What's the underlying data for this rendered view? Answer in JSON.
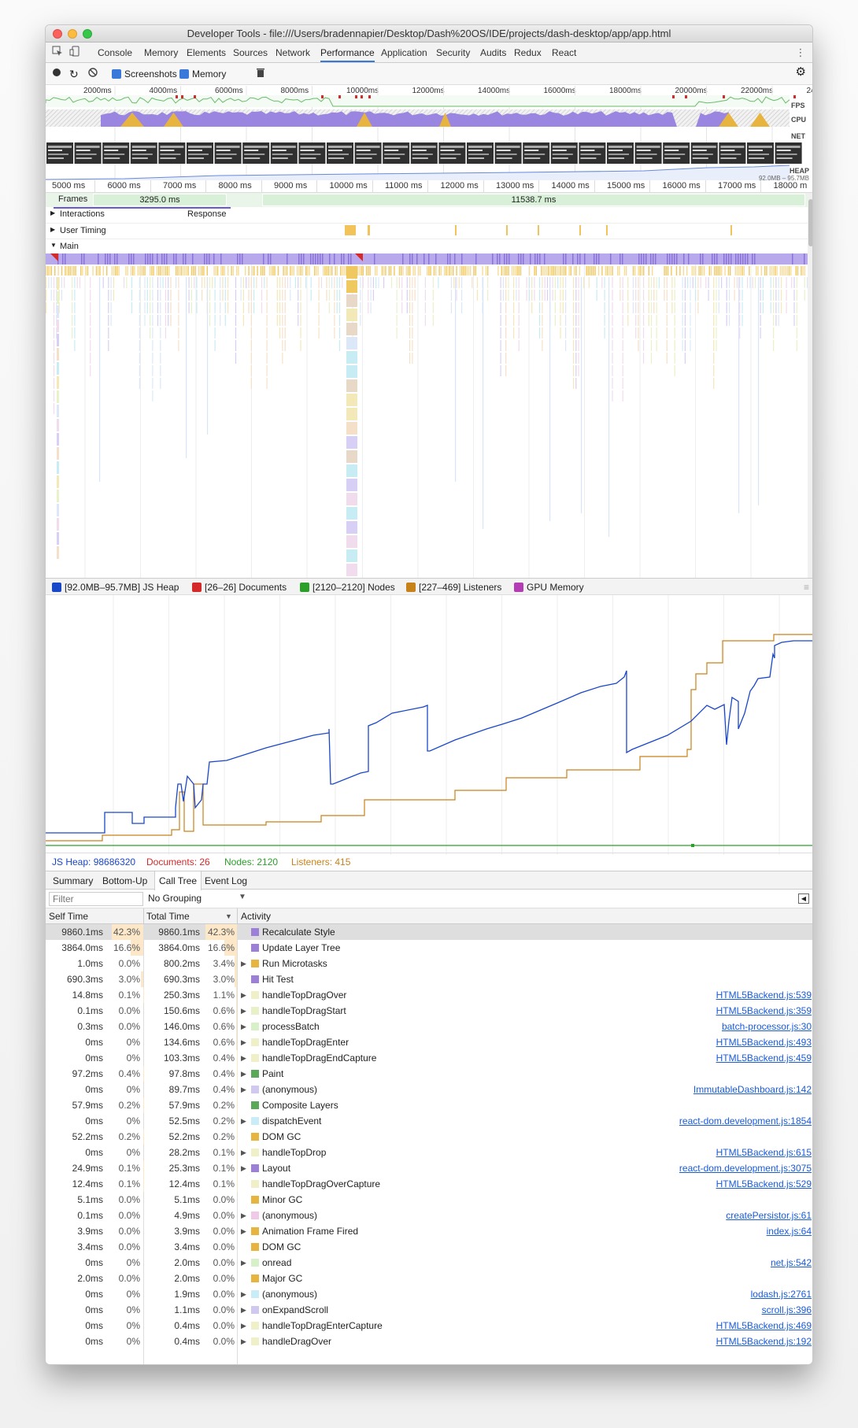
{
  "window": {
    "title": "Developer Tools - file:///Users/bradennapier/Desktop/Dash%20OS/IDE/projects/dash-desktop/app/app.html"
  },
  "tabs": [
    "Console",
    "Memory",
    "Elements",
    "Sources",
    "Network",
    "Performance",
    "Application",
    "Security",
    "Audits",
    "Redux",
    "React"
  ],
  "active_tab": "Performance",
  "toolbar": {
    "screenshots_label": "Screenshots",
    "memory_label": "Memory"
  },
  "overview": {
    "ticks": [
      "2000ms",
      "4000ms",
      "6000ms",
      "8000ms",
      "10000ms",
      "12000ms",
      "14000ms",
      "16000ms",
      "18000ms",
      "20000ms",
      "22000ms",
      "24"
    ],
    "fps_label": "FPS",
    "cpu_label": "CPU",
    "net_label": "NET",
    "heap_label": "HEAP",
    "heap_range": "92.0MB – 95.7MB"
  },
  "timeline": {
    "ticks": [
      "5000 ms",
      "6000 ms",
      "7000 ms",
      "8000 ms",
      "9000 ms",
      "10000 ms",
      "11000 ms",
      "12000 ms",
      "13000 ms",
      "14000 ms",
      "15000 ms",
      "16000 ms",
      "17000 ms",
      "18000 m"
    ],
    "frames_label": "Frames",
    "frame1": "3295.0 ms",
    "frame2": "11538.7 ms",
    "interactions_label": "Interactions",
    "response_label": "Response",
    "user_timing_label": "User Timing",
    "main_label": "Main"
  },
  "counters": {
    "heap": "[92.0MB–95.7MB]",
    "heap_label": "JS Heap",
    "documents": "[26–26]",
    "documents_label": "Documents",
    "nodes": "[2120–2120]",
    "nodes_label": "Nodes",
    "listeners": "[227–469]",
    "listeners_label": "Listeners",
    "gpu_label": "GPU Memory",
    "colors": {
      "heap": "#1a47c8",
      "documents": "#d42a2a",
      "nodes": "#2aa02a",
      "listeners": "#c8821a",
      "gpu": "#b43cb4"
    }
  },
  "readout": {
    "heap": "JS Heap: 98686320",
    "documents": "Documents: 26",
    "nodes": "Nodes: 2120",
    "listeners": "Listeners: 415"
  },
  "bottom_tabs": [
    "Summary",
    "Bottom-Up",
    "Call Tree",
    "Event Log"
  ],
  "active_bottom_tab": "Call Tree",
  "filter": {
    "placeholder": "Filter",
    "grouping": "No Grouping"
  },
  "table": {
    "headers": {
      "self": "Self Time",
      "total": "Total Time",
      "activity": "Activity"
    },
    "rows": [
      {
        "self": "9860.1ms",
        "self_pct": "42.3%",
        "total": "9860.1ms",
        "total_pct": "42.3%",
        "activity": "Recalculate Style",
        "color": "#9b7fd8",
        "expand": false,
        "link": "",
        "sp": 42.3,
        "tp": 42.3
      },
      {
        "self": "3864.0ms",
        "self_pct": "16.6%",
        "total": "3864.0ms",
        "total_pct": "16.6%",
        "activity": "Update Layer Tree",
        "color": "#9b7fd8",
        "expand": false,
        "link": "",
        "sp": 16.6,
        "tp": 16.6
      },
      {
        "self": "1.0ms",
        "self_pct": "0.0%",
        "total": "800.2ms",
        "total_pct": "3.4%",
        "activity": "Run Microtasks",
        "color": "#e8b440",
        "expand": true,
        "link": "",
        "sp": 0,
        "tp": 3.4
      },
      {
        "self": "690.3ms",
        "self_pct": "3.0%",
        "total": "690.3ms",
        "total_pct": "3.0%",
        "activity": "Hit Test",
        "color": "#9b7fd8",
        "expand": false,
        "link": "",
        "sp": 3.0,
        "tp": 3.0
      },
      {
        "self": "14.8ms",
        "self_pct": "0.1%",
        "total": "250.3ms",
        "total_pct": "1.1%",
        "activity": "handleTopDragOver",
        "color": "#f0f0c8",
        "expand": true,
        "link": "HTML5Backend.js:539",
        "sp": 0.1,
        "tp": 1.1
      },
      {
        "self": "0.1ms",
        "self_pct": "0.0%",
        "total": "150.6ms",
        "total_pct": "0.6%",
        "activity": "handleTopDragStart",
        "color": "#e8f0c8",
        "expand": true,
        "link": "HTML5Backend.js:359",
        "sp": 0,
        "tp": 0.6
      },
      {
        "self": "0.3ms",
        "self_pct": "0.0%",
        "total": "146.0ms",
        "total_pct": "0.6%",
        "activity": "processBatch",
        "color": "#d8f0c8",
        "expand": true,
        "link": "batch-processor.js:30",
        "sp": 0,
        "tp": 0.6
      },
      {
        "self": "0ms",
        "self_pct": "0%",
        "total": "134.6ms",
        "total_pct": "0.6%",
        "activity": "handleTopDragEnter",
        "color": "#f0f0c8",
        "expand": true,
        "link": "HTML5Backend.js:493",
        "sp": 0,
        "tp": 0.6
      },
      {
        "self": "0ms",
        "self_pct": "0%",
        "total": "103.3ms",
        "total_pct": "0.4%",
        "activity": "handleTopDragEndCapture",
        "color": "#f0f0c8",
        "expand": true,
        "link": "HTML5Backend.js:459",
        "sp": 0,
        "tp": 0.4
      },
      {
        "self": "97.2ms",
        "self_pct": "0.4%",
        "total": "97.8ms",
        "total_pct": "0.4%",
        "activity": "Paint",
        "color": "#5aa85a",
        "expand": true,
        "link": "",
        "sp": 0.4,
        "tp": 0.4
      },
      {
        "self": "0ms",
        "self_pct": "0%",
        "total": "89.7ms",
        "total_pct": "0.4%",
        "activity": "(anonymous)",
        "color": "#d0c8f0",
        "expand": true,
        "link": "ImmutableDashboard.js:142",
        "sp": 0,
        "tp": 0.4
      },
      {
        "self": "57.9ms",
        "self_pct": "0.2%",
        "total": "57.9ms",
        "total_pct": "0.2%",
        "activity": "Composite Layers",
        "color": "#5aa85a",
        "expand": false,
        "link": "",
        "sp": 0.2,
        "tp": 0.2
      },
      {
        "self": "0ms",
        "self_pct": "0%",
        "total": "52.5ms",
        "total_pct": "0.2%",
        "activity": "dispatchEvent",
        "color": "#c8ecf8",
        "expand": true,
        "link": "react-dom.development.js:1854",
        "sp": 0,
        "tp": 0.2
      },
      {
        "self": "52.2ms",
        "self_pct": "0.2%",
        "total": "52.2ms",
        "total_pct": "0.2%",
        "activity": "DOM GC",
        "color": "#e8b440",
        "expand": false,
        "link": "",
        "sp": 0.2,
        "tp": 0.2
      },
      {
        "self": "0ms",
        "self_pct": "0%",
        "total": "28.2ms",
        "total_pct": "0.1%",
        "activity": "handleTopDrop",
        "color": "#f0f0c8",
        "expand": true,
        "link": "HTML5Backend.js:615",
        "sp": 0,
        "tp": 0.1
      },
      {
        "self": "24.9ms",
        "self_pct": "0.1%",
        "total": "25.3ms",
        "total_pct": "0.1%",
        "activity": "Layout",
        "color": "#9b7fd8",
        "expand": true,
        "link": "react-dom.development.js:3075",
        "sp": 0.1,
        "tp": 0.1
      },
      {
        "self": "12.4ms",
        "self_pct": "0.1%",
        "total": "12.4ms",
        "total_pct": "0.1%",
        "activity": "handleTopDragOverCapture",
        "color": "#f0f0c8",
        "expand": false,
        "link": "HTML5Backend.js:529",
        "sp": 0.1,
        "tp": 0.1
      },
      {
        "self": "5.1ms",
        "self_pct": "0.0%",
        "total": "5.1ms",
        "total_pct": "0.0%",
        "activity": "Minor GC",
        "color": "#e8b440",
        "expand": false,
        "link": "",
        "sp": 0,
        "tp": 0
      },
      {
        "self": "0.1ms",
        "self_pct": "0.0%",
        "total": "4.9ms",
        "total_pct": "0.0%",
        "activity": "(anonymous)",
        "color": "#f0c8e8",
        "expand": true,
        "link": "createPersistor.js:61",
        "sp": 0,
        "tp": 0
      },
      {
        "self": "3.9ms",
        "self_pct": "0.0%",
        "total": "3.9ms",
        "total_pct": "0.0%",
        "activity": "Animation Frame Fired",
        "color": "#e8b440",
        "expand": true,
        "link": "index.js:64",
        "sp": 0,
        "tp": 0
      },
      {
        "self": "3.4ms",
        "self_pct": "0.0%",
        "total": "3.4ms",
        "total_pct": "0.0%",
        "activity": "DOM GC",
        "color": "#e8b440",
        "expand": false,
        "link": "",
        "sp": 0,
        "tp": 0
      },
      {
        "self": "0ms",
        "self_pct": "0%",
        "total": "2.0ms",
        "total_pct": "0.0%",
        "activity": "onread",
        "color": "#d8f0c8",
        "expand": true,
        "link": "net.js:542",
        "sp": 0,
        "tp": 0
      },
      {
        "self": "2.0ms",
        "self_pct": "0.0%",
        "total": "2.0ms",
        "total_pct": "0.0%",
        "activity": "Major GC",
        "color": "#e8b440",
        "expand": false,
        "link": "",
        "sp": 0,
        "tp": 0
      },
      {
        "self": "0ms",
        "self_pct": "0%",
        "total": "1.9ms",
        "total_pct": "0.0%",
        "activity": "(anonymous)",
        "color": "#c8ecf8",
        "expand": true,
        "link": "lodash.js:2761",
        "sp": 0,
        "tp": 0
      },
      {
        "self": "0ms",
        "self_pct": "0%",
        "total": "1.1ms",
        "total_pct": "0.0%",
        "activity": "onExpandScroll",
        "color": "#d0c8f0",
        "expand": true,
        "link": "scroll.js:396",
        "sp": 0,
        "tp": 0
      },
      {
        "self": "0ms",
        "self_pct": "0%",
        "total": "0.4ms",
        "total_pct": "0.0%",
        "activity": "handleTopDragEnterCapture",
        "color": "#f0f0c8",
        "expand": true,
        "link": "HTML5Backend.js:469",
        "sp": 0,
        "tp": 0
      },
      {
        "self": "0ms",
        "self_pct": "0%",
        "total": "0.4ms",
        "total_pct": "0.0%",
        "activity": "handleDragOver",
        "color": "#f0f0c8",
        "expand": true,
        "link": "HTML5Backend.js:192",
        "sp": 0,
        "tp": 0
      }
    ]
  }
}
